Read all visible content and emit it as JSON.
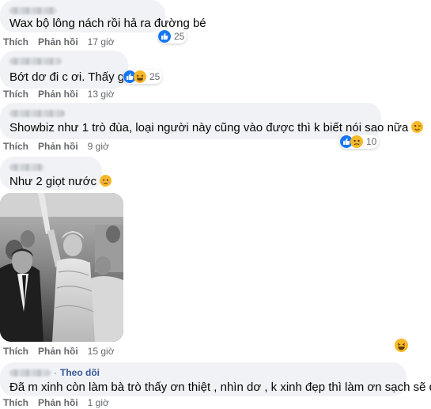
{
  "comments": [
    {
      "text": "Wax bộ lông nách rồi hả ra đường bé",
      "actions": {
        "like": "Thích",
        "reply": "Phản hồi",
        "time": "17 giờ"
      },
      "reaction_count": "25"
    },
    {
      "text": "Bớt dơ đi c ơi. Thấy gớm",
      "actions": {
        "like": "Thích",
        "reply": "Phản hồi",
        "time": "13 giờ"
      },
      "reaction_count": "25"
    },
    {
      "text": "Showbiz như 1 trò đùa, loại người này cũng vào được thì k biết nói sao nữa",
      "actions": {
        "like": "Thích",
        "reply": "Phản hồi",
        "time": "9 giờ"
      },
      "reaction_count": "10"
    },
    {
      "text": "Như 2 giọt nước",
      "actions": {
        "like": "Thích",
        "reply": "Phản hồi",
        "time": "15 giờ"
      }
    },
    {
      "follow": "Theo dõi",
      "text": "Đã m xinh còn làm bà trò thấy ơn thiệt , nhìn dơ , k xinh đẹp thì làm ơn sạch sẽ dùm",
      "actions": {
        "like": "Thích",
        "reply": "Phản hồi",
        "time": "1 giờ"
      }
    }
  ],
  "icons": {
    "like": "like-reaction-icon",
    "haha": "haha-reaction-icon",
    "sad": "sad-reaction-icon",
    "wink": "wink-emoji",
    "embarrassed": "embarrassed-emoji"
  },
  "colors": {
    "bubble": "#f0f2f5",
    "like_blue": "#1877f2",
    "emoji_yellow": "#f7b928",
    "meta_gray": "#65676b",
    "follow_link": "#385898"
  }
}
